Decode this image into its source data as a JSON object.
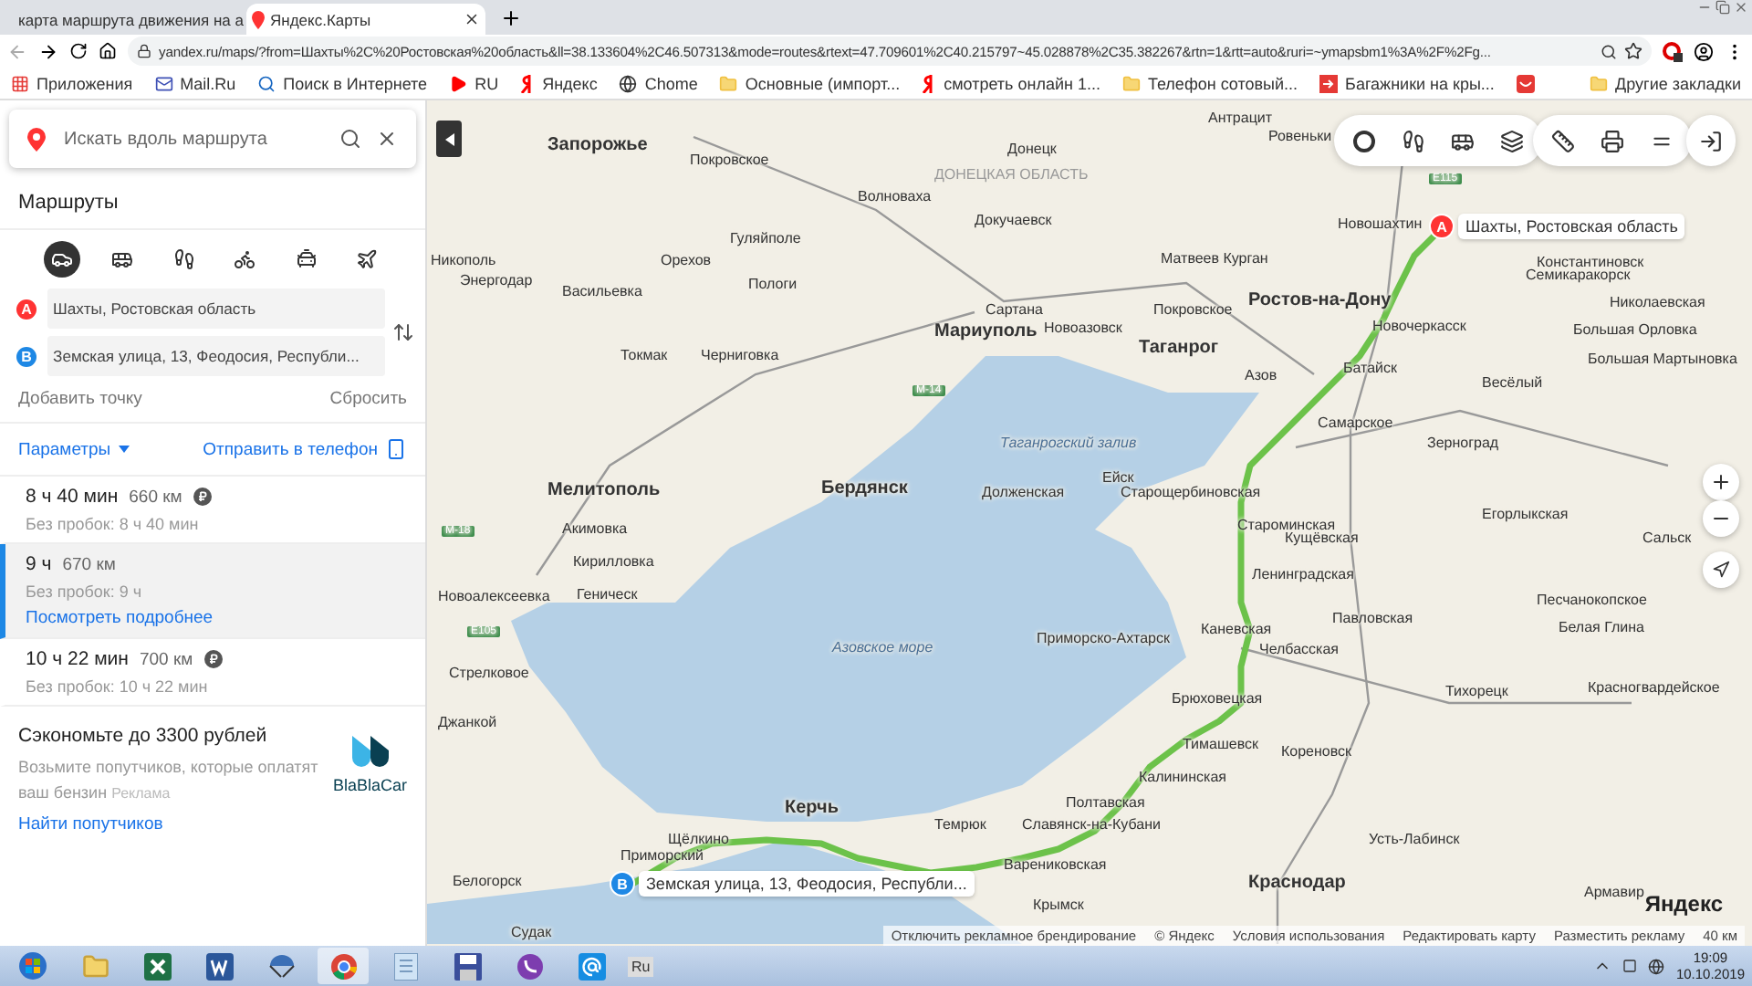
{
  "browser": {
    "tabs": [
      {
        "title": "карта маршрута движения на а",
        "selected": false
      },
      {
        "title": "Яндекс.Карты",
        "selected": true
      }
    ],
    "url": "yandex.ru/maps/?from=Шахты%2C%20Ростовская%20область&ll=38.133604%2C46.507313&mode=routes&rtext=47.709601%2C40.215797~45.028878%2C35.382267&rtn=1&rtt=auto&ruri=~ymapsbm1%3A%2F%2Fg...",
    "bookmarks": [
      {
        "label": "Приложения",
        "kind": "apps"
      },
      {
        "label": "Mail.Ru",
        "kind": "mail"
      },
      {
        "label": "Поиск в Интернете",
        "kind": "search"
      },
      {
        "label": "RU",
        "kind": "video"
      },
      {
        "label": "Яндекс",
        "kind": "yandex"
      },
      {
        "label": "Chome",
        "kind": "globe"
      },
      {
        "label": "Основные (импорт...",
        "kind": "folder"
      },
      {
        "label": "смотреть онлайн 1...",
        "kind": "yandex"
      },
      {
        "label": "Телефон сотовый...",
        "kind": "folder"
      },
      {
        "label": "Багажники на кры...",
        "kind": "arrow"
      },
      {
        "kind": "shop"
      }
    ],
    "other_bookmarks": "Другие закладки"
  },
  "sidebar": {
    "search_placeholder": "Искать вдоль маршрута",
    "title": "Маршруты",
    "modes": [
      {
        "kind": "car",
        "selected": true
      },
      {
        "kind": "bus",
        "selected": false
      },
      {
        "kind": "walk",
        "selected": false
      },
      {
        "kind": "bike",
        "selected": false
      },
      {
        "kind": "taxi",
        "selected": false
      },
      {
        "kind": "plane",
        "selected": false
      }
    ],
    "points": [
      {
        "marker": "A",
        "value": "Шахты, Ростовская область"
      },
      {
        "marker": "B",
        "value": "Земская улица, 13, Феодосия, Республи..."
      }
    ],
    "add_point": "Добавить точку",
    "reset": "Сбросить",
    "params": "Параметры",
    "send": "Отправить в телефон",
    "routes": [
      {
        "time": "8 ч 40 мин",
        "distance": "660 км",
        "toll": true,
        "no_traffic": "Без пробок: 8 ч 40 мин",
        "selected": false
      },
      {
        "time": "9 ч",
        "distance": "670 км",
        "toll": false,
        "no_traffic": "Без пробок: 9 ч",
        "details": "Посмотреть подробнее",
        "selected": true
      },
      {
        "time": "10 ч 22 мин",
        "distance": "700 км",
        "toll": true,
        "no_traffic": "Без пробок: 10 ч 22 мин",
        "selected": false
      }
    ],
    "ad": {
      "title": "Сэкономьте до 3300 рублей",
      "text": "Возьмите попутчиков, которые оплатят ваш бензин",
      "tag": "Реклама",
      "link": "Найти попутчиков",
      "brand": "BlaBlaCar"
    }
  },
  "map": {
    "labels": [
      {
        "text": "Антрацит",
        "kind": "town"
      },
      {
        "text": "Ровеньки",
        "kind": "town"
      },
      {
        "text": "Новошахтин",
        "kind": "town"
      },
      {
        "text": "Донецк",
        "kind": "town"
      },
      {
        "text": "ДОНЕЦКАЯ ОБЛАСТЬ",
        "kind": "region"
      },
      {
        "text": "Запорожье",
        "kind": "city"
      },
      {
        "text": "Покровское",
        "kind": "town"
      },
      {
        "text": "Волноваха",
        "kind": "town"
      },
      {
        "text": "Докучаевск",
        "kind": "town"
      },
      {
        "text": "Никополь",
        "kind": "town"
      },
      {
        "text": "Энергодар",
        "kind": "town"
      },
      {
        "text": "Васильевка",
        "kind": "town"
      },
      {
        "text": "Орехов",
        "kind": "town"
      },
      {
        "text": "Гуляйполе",
        "kind": "town"
      },
      {
        "text": "Пологи",
        "kind": "town"
      },
      {
        "text": "Токмак",
        "kind": "town"
      },
      {
        "text": "Черниговка",
        "kind": "town"
      },
      {
        "text": "Мелитополь",
        "kind": "city"
      },
      {
        "text": "Акимовка",
        "kind": "town"
      },
      {
        "text": "Кирилловка",
        "kind": "town"
      },
      {
        "text": "Бердянск",
        "kind": "city"
      },
      {
        "text": "Сартана",
        "kind": "town"
      },
      {
        "text": "Мариуполь",
        "kind": "city"
      },
      {
        "text": "Новоазовск",
        "kind": "town"
      },
      {
        "text": "Таганрог",
        "kind": "city"
      },
      {
        "text": "Ростов-на-Дону",
        "kind": "city"
      },
      {
        "text": "Азов",
        "kind": "town"
      },
      {
        "text": "Батайск",
        "kind": "town"
      },
      {
        "text": "Новочеркасск",
        "kind": "town"
      },
      {
        "text": "Матвеев Курган",
        "kind": "town"
      },
      {
        "text": "Покровское",
        "kind": "town"
      },
      {
        "text": "Константиновск",
        "kind": "town"
      },
      {
        "text": "Семикаракорск",
        "kind": "town"
      },
      {
        "text": "Николаевская",
        "kind": "town"
      },
      {
        "text": "Большая Орловка",
        "kind": "town"
      },
      {
        "text": "Большая Мартыновка",
        "kind": "town"
      },
      {
        "text": "Весёлый",
        "kind": "town"
      },
      {
        "text": "Зерноград",
        "kind": "town"
      },
      {
        "text": "Самарское",
        "kind": "town"
      },
      {
        "text": "Таганрогский залив",
        "kind": "water"
      },
      {
        "text": "Ейск",
        "kind": "town"
      },
      {
        "text": "Долженская",
        "kind": "town"
      },
      {
        "text": "Старощербиновская",
        "kind": "town"
      },
      {
        "text": "Староминская",
        "kind": "town"
      },
      {
        "text": "Кущёвская",
        "kind": "town"
      },
      {
        "text": "Ленинградская",
        "kind": "town"
      },
      {
        "text": "Егорлыкская",
        "kind": "town"
      },
      {
        "text": "Сальск",
        "kind": "town"
      },
      {
        "text": "Песчанокопское",
        "kind": "town"
      },
      {
        "text": "Белая Глина",
        "kind": "town"
      },
      {
        "text": "Павловская",
        "kind": "town"
      },
      {
        "text": "Каневская",
        "kind": "town"
      },
      {
        "text": "Челбасская",
        "kind": "town"
      },
      {
        "text": "Приморско-Ахтарск",
        "kind": "town"
      },
      {
        "text": "Азовское море",
        "kind": "water"
      },
      {
        "text": "Новоалексеевка",
        "kind": "town"
      },
      {
        "text": "Геническ",
        "kind": "town"
      },
      {
        "text": "Стрелковое",
        "kind": "town"
      },
      {
        "text": "Джанкой",
        "kind": "town"
      },
      {
        "text": "Тихорецк",
        "kind": "town"
      },
      {
        "text": "Красногвардейское",
        "kind": "town"
      },
      {
        "text": "Брюховецкая",
        "kind": "town"
      },
      {
        "text": "Тимашевск",
        "kind": "town"
      },
      {
        "text": "Кореновск",
        "kind": "town"
      },
      {
        "text": "Калининская",
        "kind": "town"
      },
      {
        "text": "Полтавская",
        "kind": "town"
      },
      {
        "text": "Славянск-на-Кубани",
        "kind": "town"
      },
      {
        "text": "Усть-Лабинск",
        "kind": "town"
      },
      {
        "text": "Краснодар",
        "kind": "city"
      },
      {
        "text": "Армавир",
        "kind": "town"
      },
      {
        "text": "Щёлкино",
        "kind": "town"
      },
      {
        "text": "Керчь",
        "kind": "city"
      },
      {
        "text": "Темрюк",
        "kind": "town"
      },
      {
        "text": "Варениковская",
        "kind": "town"
      },
      {
        "text": "Крымск",
        "kind": "town"
      },
      {
        "text": "Приморский",
        "kind": "town"
      },
      {
        "text": "Белогорск",
        "kind": "town"
      },
      {
        "text": "Судак",
        "kind": "town"
      },
      {
        "text": "E115",
        "kind": "road"
      },
      {
        "text": "M-14",
        "kind": "road"
      },
      {
        "text": "E105",
        "kind": "road"
      },
      {
        "text": "M-18",
        "kind": "road"
      }
    ],
    "pins": [
      {
        "marker": "A",
        "label": "Шахты, Ростовская область"
      },
      {
        "marker": "B",
        "label": "Земская улица, 13, Феодосия, Республи..."
      }
    ],
    "logo": "Яндекс",
    "footer": [
      "Отключить рекламное брендирование",
      "© Яндекс",
      "Условия использования",
      "Редактировать карту",
      "Разместить рекламу"
    ],
    "scale": "40 км"
  },
  "taskbar": {
    "apps": [
      {
        "kind": "folder",
        "selected": false
      },
      {
        "kind": "excel",
        "selected": false
      },
      {
        "kind": "word",
        "selected": false
      },
      {
        "kind": "parachute",
        "selected": false
      },
      {
        "kind": "chrome",
        "selected": true
      },
      {
        "kind": "notes",
        "selected": false
      },
      {
        "kind": "disk",
        "selected": false
      },
      {
        "kind": "viber",
        "selected": false
      },
      {
        "kind": "mail",
        "selected": false
      }
    ],
    "lang": "Ru",
    "time": "19:09",
    "date": "10.10.2019"
  }
}
